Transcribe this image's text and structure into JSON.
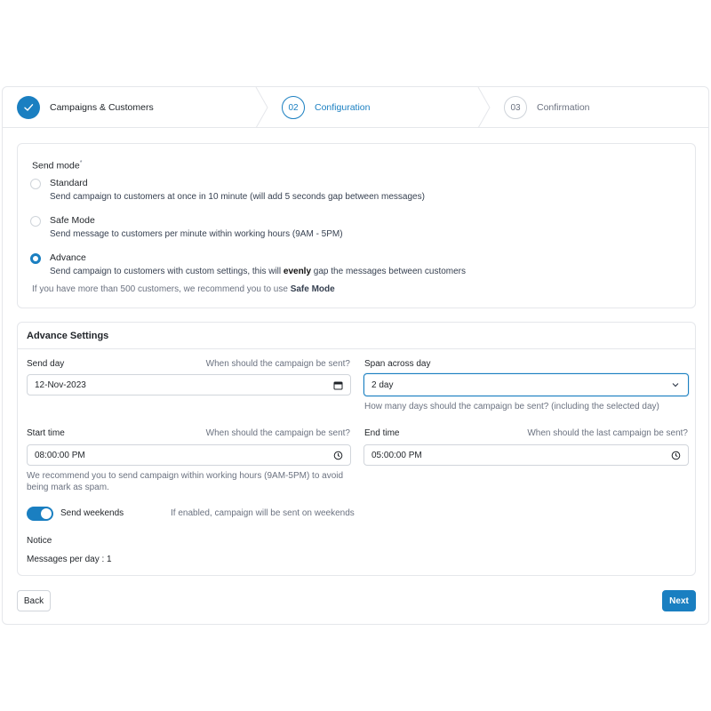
{
  "stepper": {
    "steps": [
      {
        "number": "",
        "label": "Campaigns & Customers",
        "state": "completed"
      },
      {
        "number": "02",
        "label": "Configuration",
        "state": "active"
      },
      {
        "number": "03",
        "label": "Confirmation",
        "state": "pending"
      }
    ]
  },
  "send_mode": {
    "title": "Send mode",
    "required_mark": "*",
    "options": [
      {
        "title": "Standard",
        "description": "Send campaign to customers at once in 10 minute (will add 5 seconds gap between messages)",
        "selected": false
      },
      {
        "title": "Safe Mode",
        "description": "Send message to customers per minute within working hours (9AM - 5PM)",
        "selected": false
      },
      {
        "title": "Advance",
        "description_before": "Send campaign to customers with custom settings, this will ",
        "description_bold": "evenly",
        "description_after": " gap the messages between customers",
        "selected": true
      }
    ],
    "hint_before": "If you have more than 500 customers, we recommend you to use ",
    "hint_bold": "Safe Mode"
  },
  "advance_settings": {
    "title": "Advance Settings",
    "send_day": {
      "label": "Send day",
      "hint": "When should the campaign be sent?",
      "value": "12-Nov-2023"
    },
    "span_across_day": {
      "label": "Span across day",
      "value": "2 day",
      "help": "How many days should the campaign be sent? (including the selected day)"
    },
    "start_time": {
      "label": "Start time",
      "hint": "When should the campaign be sent?",
      "value": "08:00:00 PM",
      "help": "We recommend you to send campaign within working hours (9AM-5PM) to avoid being mark as spam."
    },
    "end_time": {
      "label": "End time",
      "hint": "When should the last campaign be sent?",
      "value": "05:00:00 PM"
    },
    "send_weekends": {
      "label": "Send weekends",
      "hint": "If enabled, campaign will be sent on weekends",
      "enabled": true
    },
    "notice": {
      "title": "Notice",
      "text": "Messages per day : 1"
    }
  },
  "footer": {
    "back_label": "Back",
    "next_label": "Next"
  },
  "colors": {
    "accent": "#1a7fc1",
    "border": "#e5e7eb",
    "muted_text": "#6b7280"
  },
  "icons": [
    "check-icon",
    "chevron-divider-icon",
    "calendar-icon",
    "chevron-down-icon",
    "clock-icon"
  ]
}
